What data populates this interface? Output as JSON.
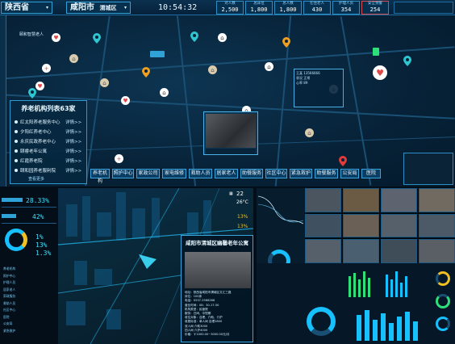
{
  "header": {
    "province": "陕西省",
    "city": "咸阳市",
    "district": "渭城区",
    "time": "10:54:32",
    "stats": [
      {
        "label": "对人数",
        "value": "2,500"
      },
      {
        "label": "总床位",
        "value": "1,800"
      },
      {
        "label": "总人数",
        "value": "1,800"
      },
      {
        "label": "在住老人",
        "value": "430"
      },
      {
        "label": "护理人员",
        "value": "354"
      },
      {
        "label": "安全预警",
        "value": "254"
      }
    ]
  },
  "map": {
    "label_top": "颐和智慧老人",
    "callout": [
      "王某 13566666",
      "状况 正常",
      "心率 89"
    ],
    "categories": [
      "养老机构",
      "照护中心",
      "家政公司",
      "家电维修",
      "救助人员",
      "居家老人",
      "助餐服务",
      "社区中心",
      "紧急救护",
      "助餐服务",
      "公安局",
      "医院"
    ]
  },
  "elder_list": {
    "title": "养老机构列表63家",
    "more": "查看更多",
    "detail_label": "详情>>",
    "items": [
      "红太阳养老服务中心",
      "夕阳红养老中心",
      "永庆民政养老中心",
      "颐睿老年公寓",
      "红霞养老院",
      "颐和园养老服利院"
    ]
  },
  "left_stats": {
    "percents": [
      "28.33%",
      "42%",
      "1%",
      "13%",
      "1.3%"
    ],
    "legend_labels": [
      "养老机构",
      "照护中心",
      "护理人员",
      "居家老人",
      "家政服务",
      "救助人员",
      "社区中心",
      "医院",
      "公安局",
      "紧急救护"
    ]
  },
  "info_card": {
    "title": "咸阳市渭城区幽馨老年公寓",
    "lines": [
      "地址：陕西省咸阳市渭城区文汇三路",
      "床位：100床",
      "电话：0537-2566266",
      "营业时间：08：30-17:30",
      "机构类型：民营院",
      "服务：日间、中短期",
      "收住对象：自理、介助、介护",
      "收费标准：单人间 自理2800",
      "双人间 介助3000",
      "四人间 介护4000",
      "价格：￥1000.00~3000.00元/月"
    ]
  },
  "weather": {
    "date": "22",
    "temp": "26°C",
    "pct_a": "13%",
    "pct_b": "13%"
  },
  "colors": {
    "accent": "#3ee0ff",
    "panel_border": "#2b9ad3",
    "warn": "#ff4b4b",
    "green": "#2ee07a"
  }
}
